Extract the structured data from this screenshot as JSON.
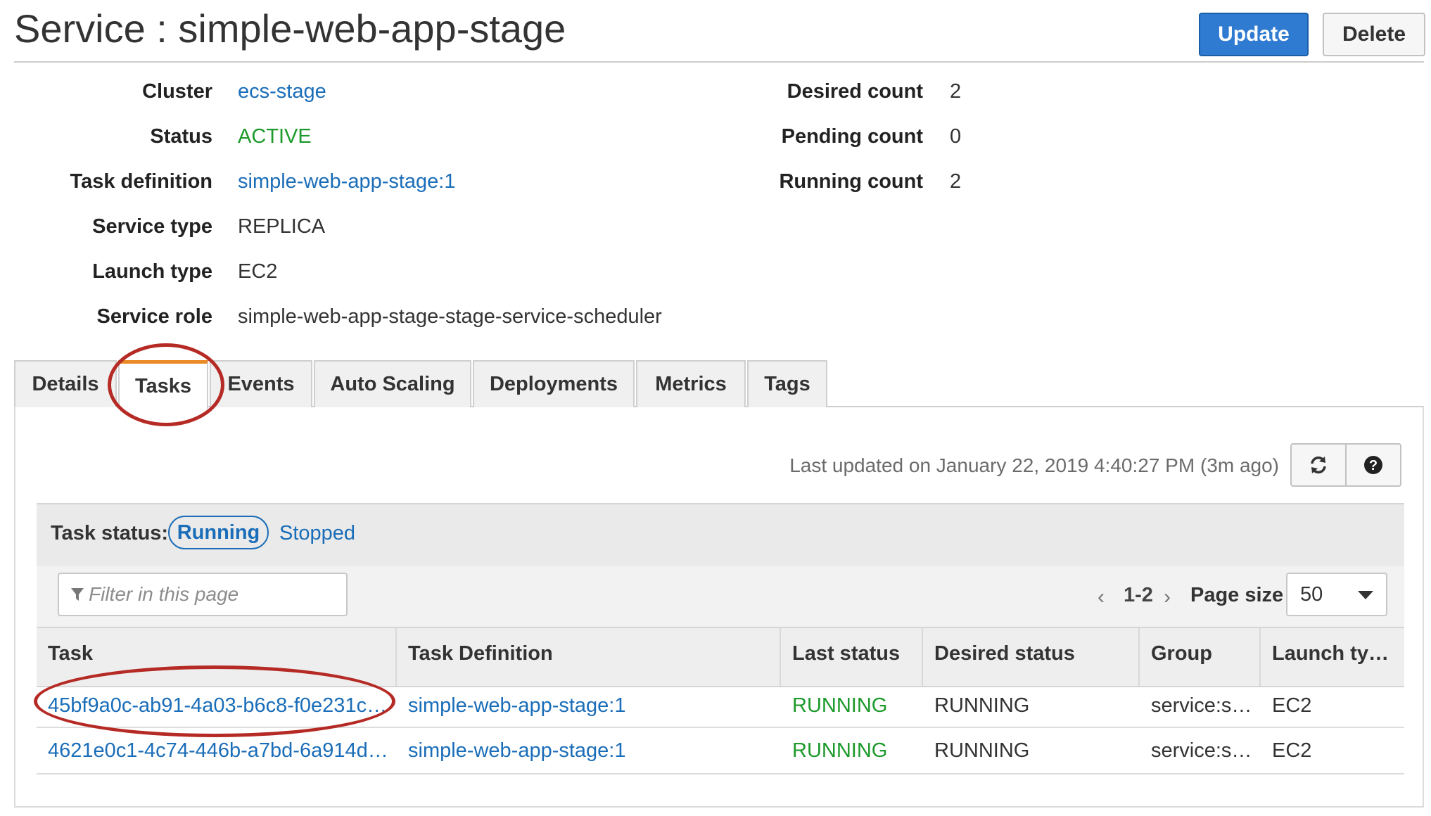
{
  "header": {
    "title": "Service : simple-web-app-stage",
    "update_label": "Update",
    "delete_label": "Delete"
  },
  "details": {
    "cluster_label": "Cluster",
    "cluster_value": "ecs-stage",
    "status_label": "Status",
    "status_value": "ACTIVE",
    "task_def_label": "Task definition",
    "task_def_value": "simple-web-app-stage:1",
    "service_type_label": "Service type",
    "service_type_value": "REPLICA",
    "launch_type_label": "Launch type",
    "launch_type_value": "EC2",
    "service_role_label": "Service role",
    "service_role_value": "simple-web-app-stage-stage-service-scheduler"
  },
  "counts": {
    "desired_label": "Desired count",
    "desired_value": "2",
    "pending_label": "Pending count",
    "pending_value": "0",
    "running_label": "Running count",
    "running_value": "2"
  },
  "tabs": [
    {
      "label": "Details",
      "active": false
    },
    {
      "label": "Tasks",
      "active": true
    },
    {
      "label": "Events",
      "active": false
    },
    {
      "label": "Auto Scaling",
      "active": false
    },
    {
      "label": "Deployments",
      "active": false
    },
    {
      "label": "Metrics",
      "active": false
    },
    {
      "label": "Tags",
      "active": false
    }
  ],
  "tasks_panel": {
    "last_updated": "Last updated on January 22, 2019 4:40:27 PM (3m ago)",
    "refresh_icon": "refresh-icon",
    "help_icon": "question-circle-icon",
    "task_status_label": "Task status:",
    "running_label": "Running",
    "stopped_label": "Stopped",
    "filter_placeholder": "Filter in this page",
    "filter_icon": "filter-icon",
    "prev_glyph": "‹",
    "page_range": "1-2",
    "next_glyph": "›",
    "page_size_label": "Page size",
    "page_size_value": "50"
  },
  "table": {
    "columns": [
      "Task",
      "Task Definition",
      "Last status",
      "Desired status",
      "Group",
      "Launch ty…"
    ],
    "rows": [
      {
        "task": "45bf9a0c-ab91-4a03-b6c8-f0e231c…",
        "task_definition": "simple-web-app-stage:1",
        "last_status": "RUNNING",
        "desired_status": "RUNNING",
        "group": "service:s…",
        "launch_type": "EC2"
      },
      {
        "task": "4621e0c1-4c74-446b-a7bd-6a914d…",
        "task_definition": "simple-web-app-stage:1",
        "last_status": "RUNNING",
        "desired_status": "RUNNING",
        "group": "service:s…",
        "launch_type": "EC2"
      }
    ]
  },
  "colors": {
    "primary_button": "#2f7bd2",
    "link": "#1a6db8",
    "status_ok": "#1d9a2b",
    "active_tab_accent": "#e98a26",
    "annotation_ring": "#b52a24"
  }
}
